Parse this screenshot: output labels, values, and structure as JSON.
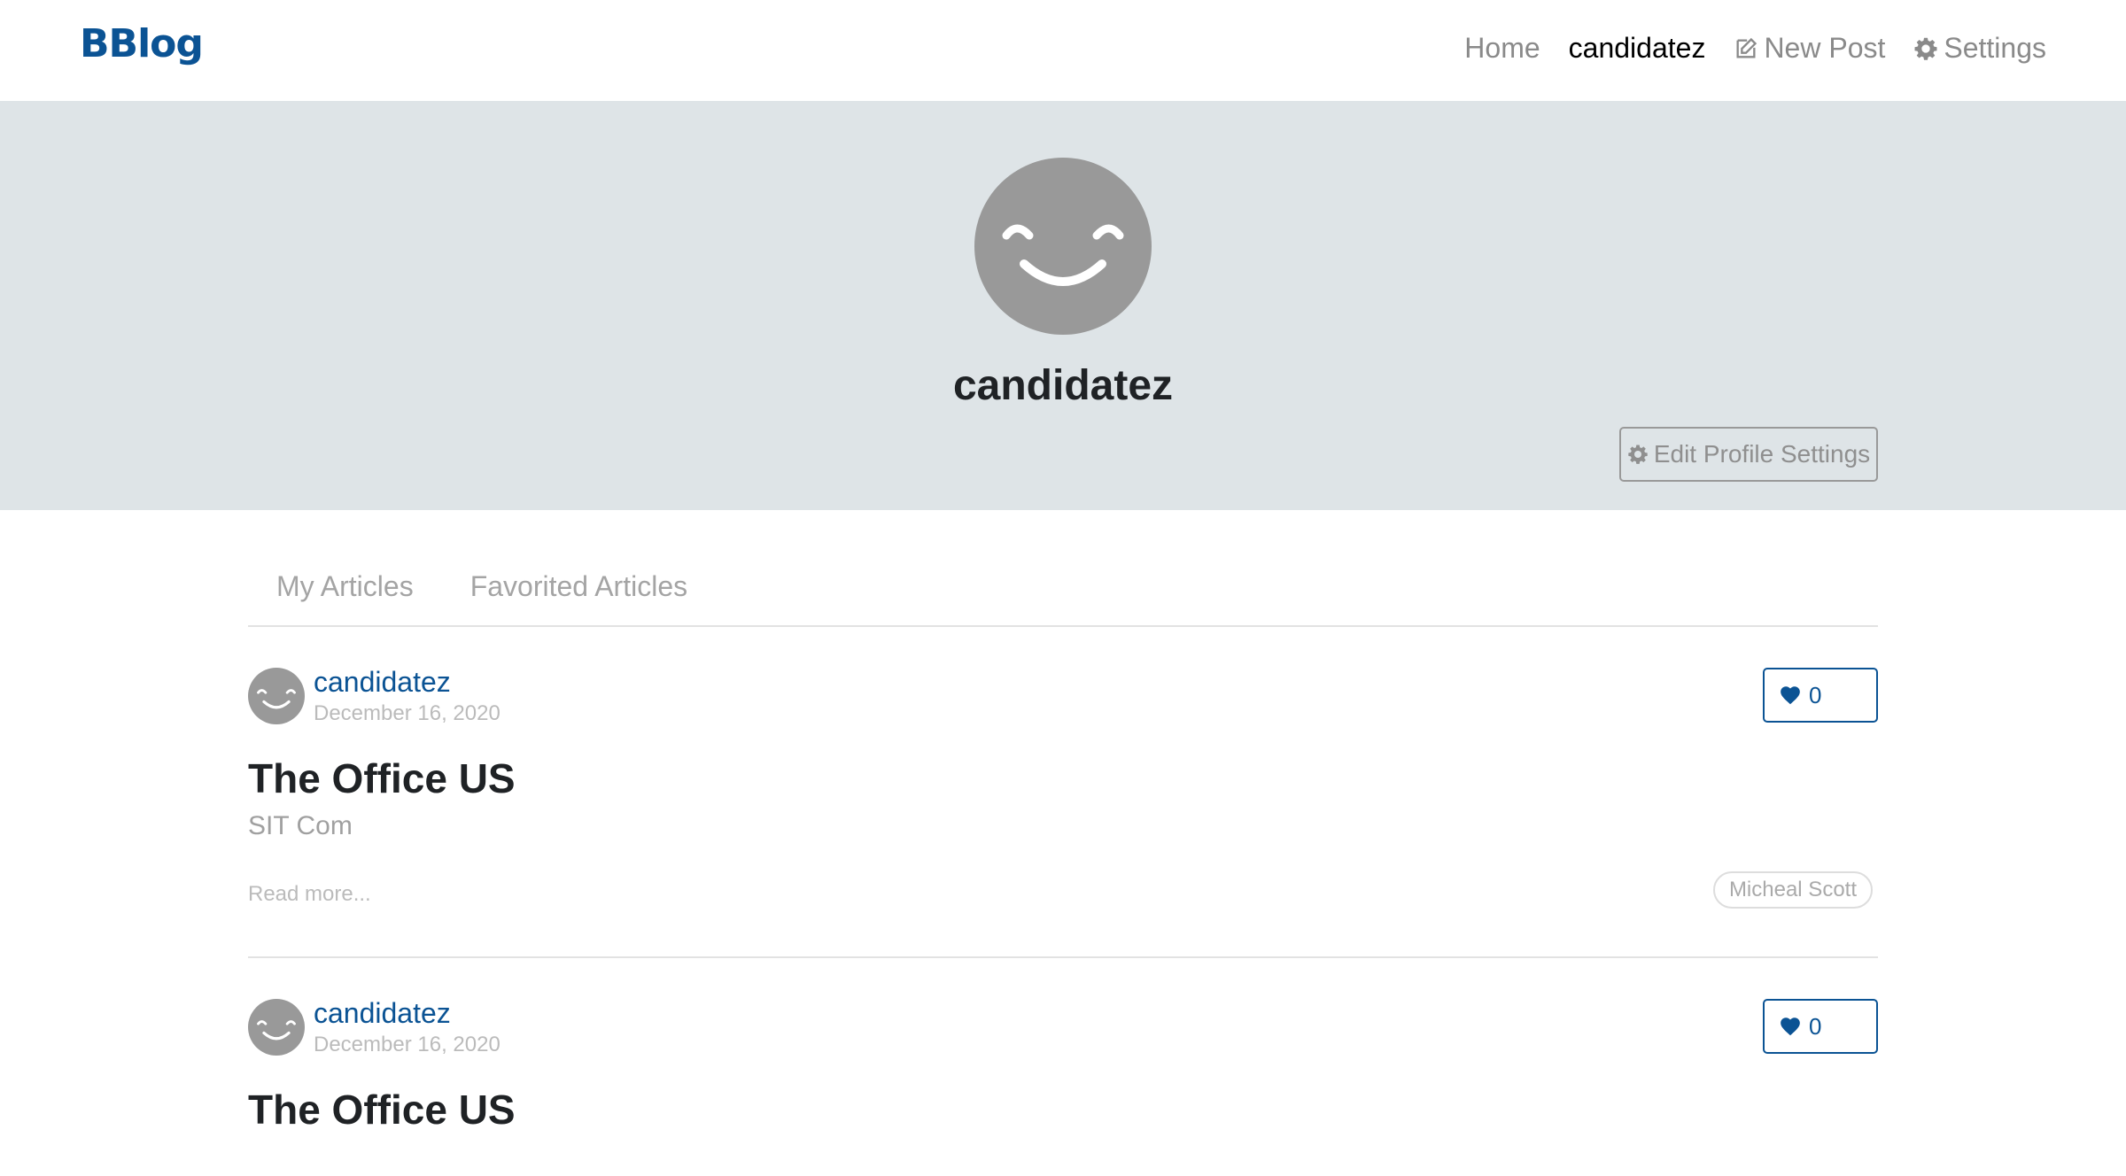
{
  "navbar": {
    "brand": "BBlog",
    "links": [
      {
        "label": "Home",
        "icon": ""
      },
      {
        "label": "candidatez",
        "icon": ""
      },
      {
        "label": "New Post",
        "icon": "edit-icon"
      },
      {
        "label": "Settings",
        "icon": "gear-icon"
      }
    ]
  },
  "profile": {
    "username": "candidatez",
    "avatar": "smiley-face-icon",
    "edit_button": "Edit Profile Settings"
  },
  "tabs": [
    "My Articles",
    "Favorited Articles"
  ],
  "articles": [
    {
      "author": "candidatez",
      "date": "December 16, 2020",
      "favorites": "0",
      "title": "The Office US",
      "description": "SIT Com",
      "read_more": "Read more...",
      "tag": "Micheal Scott"
    },
    {
      "author": "candidatez",
      "date": "December 16, 2020",
      "favorites": "0",
      "title": "The Office US"
    }
  ],
  "colors": {
    "brand": "#0b5394",
    "banner_bg": "#dee4e7",
    "avatar_gray": "#999999"
  }
}
